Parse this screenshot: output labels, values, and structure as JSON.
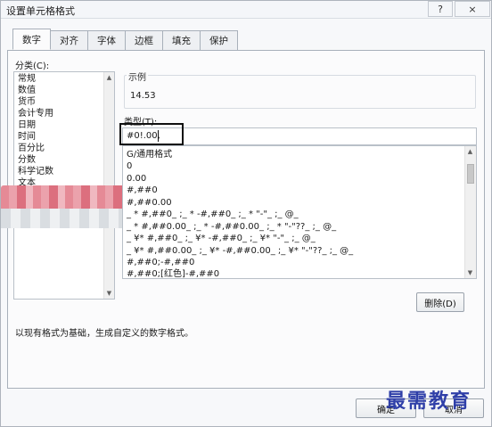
{
  "window": {
    "title": "设置单元格格式",
    "help_symbol": "?",
    "close_symbol": "×"
  },
  "tabs": [
    {
      "label": "数字",
      "active": true
    },
    {
      "label": "对齐"
    },
    {
      "label": "字体"
    },
    {
      "label": "边框"
    },
    {
      "label": "填充"
    },
    {
      "label": "保护"
    }
  ],
  "category": {
    "label": "分类(C):",
    "items": [
      "常规",
      "数值",
      "货币",
      "会计专用",
      "日期",
      "时间",
      "百分比",
      "分数",
      "科学记数",
      "文本"
    ]
  },
  "sample": {
    "legend": "示例",
    "value": "14.53"
  },
  "type_field": {
    "label": "类型(T):",
    "value": "#0!.00,"
  },
  "format_list": [
    "G/通用格式",
    "0",
    "0.00",
    "#,##0",
    "#,##0.00",
    "_ * #,##0_ ;_ * -#,##0_ ;_ * \"-\"_ ;_ @_",
    "_ * #,##0.00_ ;_ * -#,##0.00_ ;_ * \"-\"??_ ;_ @_",
    "_ ¥* #,##0_ ;_ ¥* -#,##0_ ;_ ¥* \"-\"_ ;_ @_",
    "_ ¥* #,##0.00_ ;_ ¥* -#,##0.00_ ;_ ¥* \"-\"??_ ;_ @_",
    "#,##0;-#,##0",
    "#,##0;[红色]-#,##0"
  ],
  "buttons": {
    "delete": "删除(D)",
    "ok": "确定",
    "cancel": "取消"
  },
  "description": "以现有格式为基础，生成自定义的数字格式。",
  "watermark": "最需教育",
  "scroll_symbols": {
    "up": "▲",
    "down": "▼"
  }
}
